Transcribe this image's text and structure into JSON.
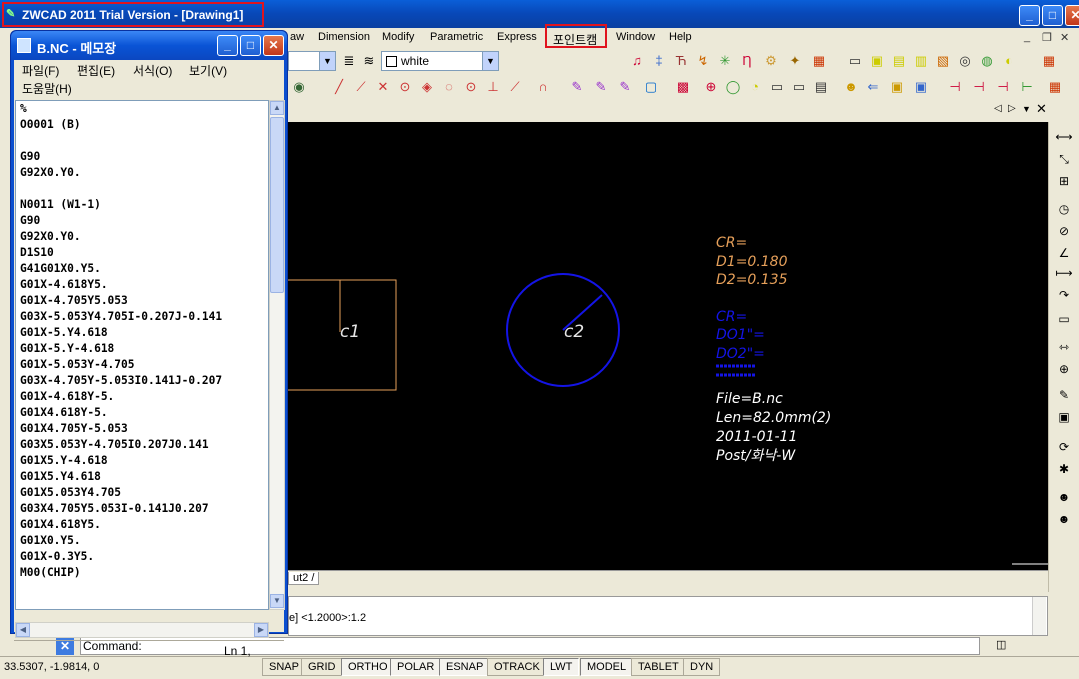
{
  "cad": {
    "title": "ZWCAD 2011 Trial Version - [Drawing1]",
    "menu": [
      "aw",
      "Dimension",
      "Modify",
      "Parametric",
      "Express",
      "포인트캠",
      "Window",
      "Help"
    ],
    "color_combo": "white",
    "tab_prefix": "ut2",
    "cmd_history": "e] <1.2000>:1.2",
    "cmd_prompt": "Command:",
    "coords": "33.5307,  -1.9814,  0",
    "status_buttons": [
      "SNAP",
      "GRID",
      "ORTHO",
      "POLAR",
      "ESNAP",
      "OTRACK",
      "LWT",
      "MODEL",
      "TABLET",
      "DYN"
    ],
    "drawing": {
      "labels": [
        "c1",
        "c2"
      ],
      "cr_orange": [
        "CR=",
        "D1=0.180",
        "D2=0.135"
      ],
      "cr_blue": [
        "CR=",
        "DO1\"=",
        "DO2\"="
      ],
      "info": [
        "File=B.nc",
        "Len=82.0mm(2)",
        "2011-01-11",
        "Post/화낙-W"
      ]
    },
    "colors": {
      "orange": "#e6a05a",
      "blue": "#1414e6",
      "highlight": "#e0141e"
    }
  },
  "notepad": {
    "title": "B.NC - 메모장",
    "menu": [
      "파일(F)",
      "편집(E)",
      "서식(O)",
      "보기(V)",
      "도움말(H)"
    ],
    "status": "Ln 1,",
    "lines": [
      "%",
      "O0001 (B)",
      "",
      "G90",
      "G92X0.Y0.",
      "",
      "N0011 (W1-1)",
      "G90",
      "G92X0.Y0.",
      "D1S10",
      "G41G01X0.Y5.",
      "G01X-4.618Y5.",
      "G01X-4.705Y5.053",
      "G03X-5.053Y4.705I-0.207J-0.141",
      "G01X-5.Y4.618",
      "G01X-5.Y-4.618",
      "G01X-5.053Y-4.705",
      "G03X-4.705Y-5.053I0.141J-0.207",
      "G01X-4.618Y-5.",
      "G01X4.618Y-5.",
      "G01X4.705Y-5.053",
      "G03X5.053Y-4.705I0.207J0.141",
      "G01X5.Y-4.618",
      "G01X5.Y4.618",
      "G01X5.053Y4.705",
      "G03X4.705Y5.053I-0.141J0.207",
      "G01X4.618Y5.",
      "G01X0.Y5.",
      "G01X-0.3Y5.",
      "M00(CHIP)"
    ]
  }
}
